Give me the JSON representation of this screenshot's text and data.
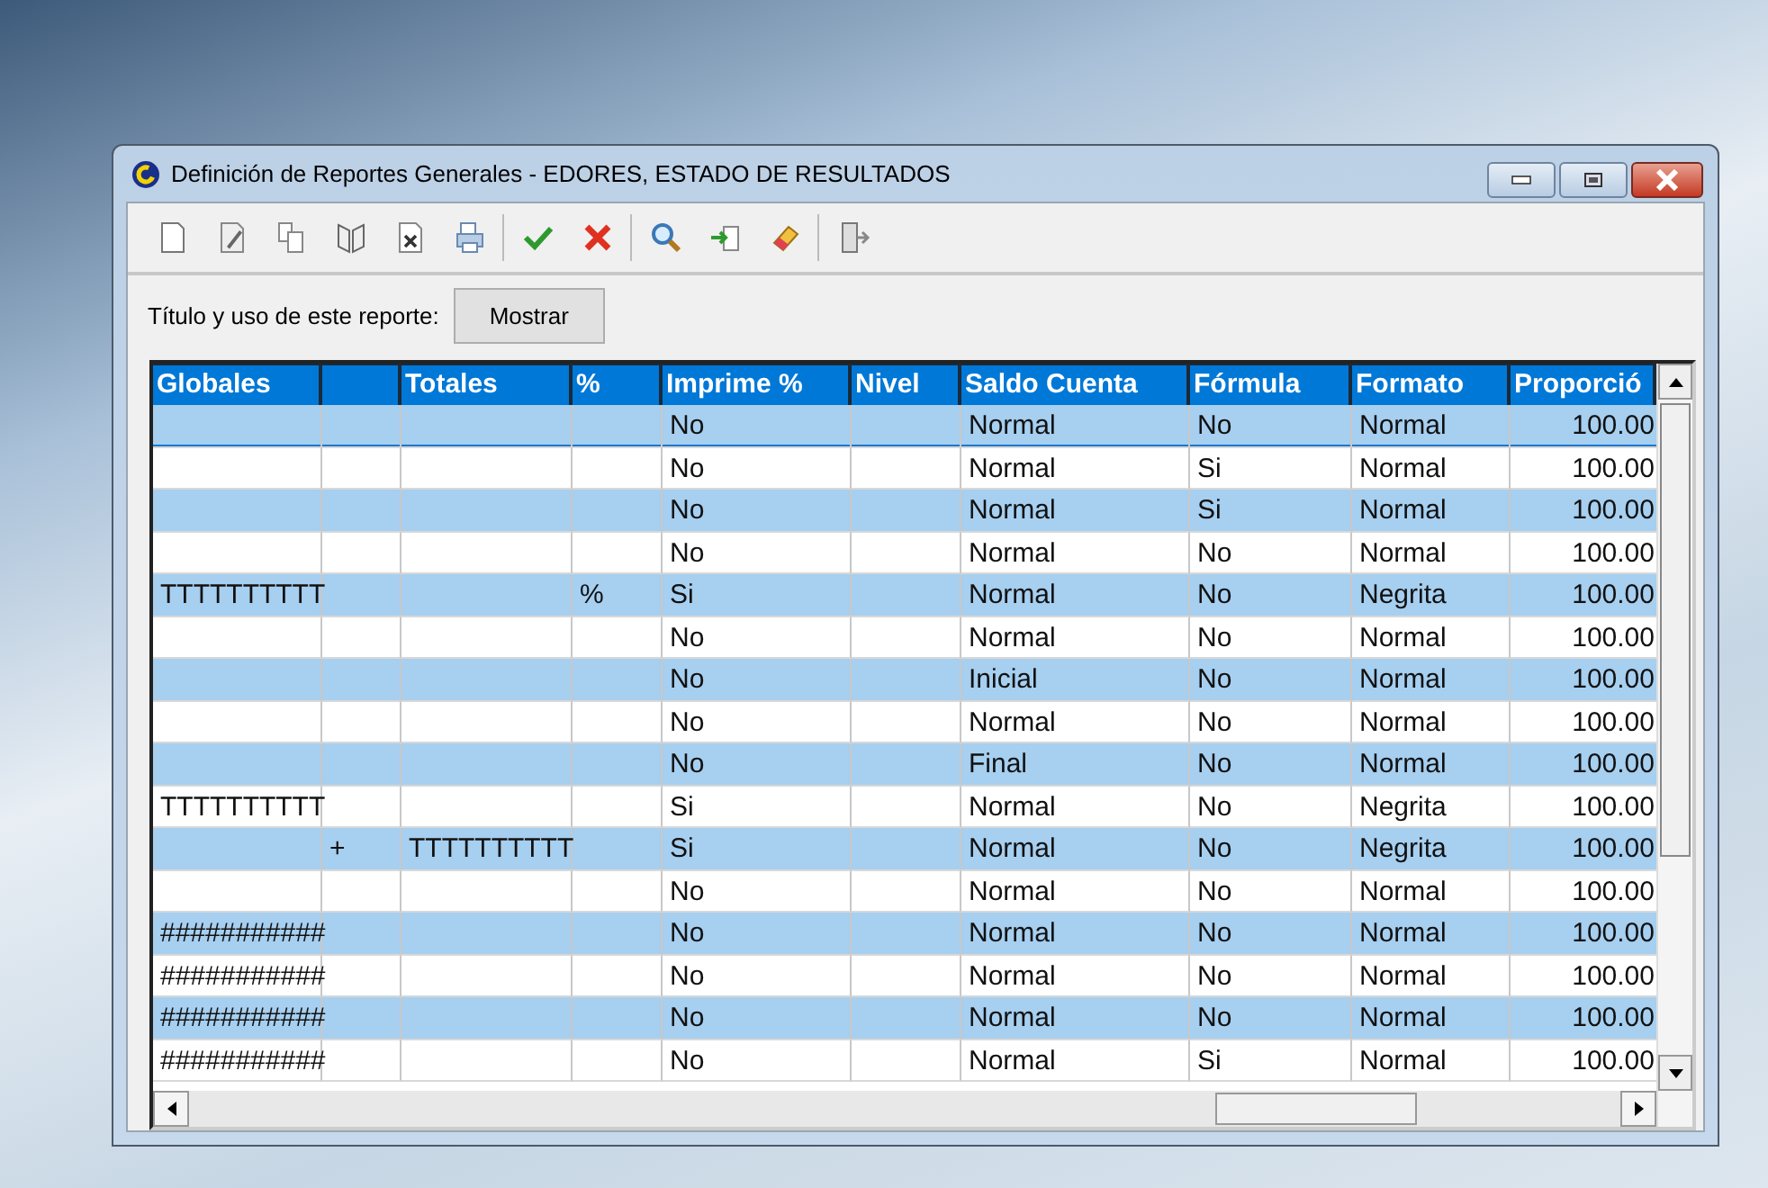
{
  "window": {
    "title": "Definición de Reportes Generales - EDORES, ESTADO DE RESULTADOS"
  },
  "toolbar": [
    {
      "kind": "new"
    },
    {
      "kind": "edit"
    },
    {
      "kind": "copy"
    },
    {
      "kind": "book"
    },
    {
      "kind": "delete"
    },
    {
      "kind": "print"
    },
    {
      "kind": "sep"
    },
    {
      "kind": "accept"
    },
    {
      "kind": "cancel"
    },
    {
      "kind": "sep"
    },
    {
      "kind": "search"
    },
    {
      "kind": "import"
    },
    {
      "kind": "eraser"
    },
    {
      "kind": "sep"
    },
    {
      "kind": "exit"
    }
  ],
  "report_usage": {
    "label": "Título y uso de este reporte:",
    "button": "Mostrar"
  },
  "table": {
    "columns": [
      "Globales",
      "",
      "Totales",
      "%",
      "Imprime %",
      "Nivel",
      "Saldo Cuenta",
      "Fórmula",
      "Formato",
      "Proporció"
    ],
    "rows": [
      {
        "selected": true,
        "cells": [
          "",
          "",
          "",
          "",
          "No",
          "",
          "Normal",
          "No",
          "Normal",
          "100.00"
        ]
      },
      {
        "selected": false,
        "cells": [
          "",
          "",
          "",
          "",
          "No",
          "",
          "Normal",
          "Si",
          "Normal",
          "100.00"
        ]
      },
      {
        "selected": false,
        "cells": [
          "",
          "",
          "",
          "",
          "No",
          "",
          "Normal",
          "Si",
          "Normal",
          "100.00"
        ]
      },
      {
        "selected": false,
        "cells": [
          "",
          "",
          "",
          "",
          "No",
          "",
          "Normal",
          "No",
          "Normal",
          "100.00"
        ]
      },
      {
        "selected": false,
        "cells": [
          "TTTTTTTTTT",
          "",
          "",
          "%",
          "Si",
          "",
          "Normal",
          "No",
          "Negrita",
          "100.00"
        ]
      },
      {
        "selected": false,
        "cells": [
          "",
          "",
          "",
          "",
          "No",
          "",
          "Normal",
          "No",
          "Normal",
          "100.00"
        ]
      },
      {
        "selected": false,
        "cells": [
          "",
          "",
          "",
          "",
          "No",
          "",
          "Inicial",
          "No",
          "Normal",
          "100.00"
        ]
      },
      {
        "selected": false,
        "cells": [
          "",
          "",
          "",
          "",
          "No",
          "",
          "Normal",
          "No",
          "Normal",
          "100.00"
        ]
      },
      {
        "selected": false,
        "cells": [
          "",
          "",
          "",
          "",
          "No",
          "",
          "Final",
          "No",
          "Normal",
          "100.00"
        ]
      },
      {
        "selected": false,
        "cells": [
          "TTTTTTTTTT",
          "",
          "",
          "",
          "Si",
          "",
          "Normal",
          "No",
          "Negrita",
          "100.00"
        ]
      },
      {
        "selected": false,
        "cells": [
          "",
          "+",
          "TTTTTTTTTT",
          "",
          "Si",
          "",
          "Normal",
          "No",
          "Negrita",
          "100.00"
        ]
      },
      {
        "selected": false,
        "cells": [
          "",
          "",
          "",
          "",
          "No",
          "",
          "Normal",
          "No",
          "Normal",
          "100.00"
        ]
      },
      {
        "selected": false,
        "cells": [
          "###########",
          "",
          "",
          "",
          "No",
          "",
          "Normal",
          "No",
          "Normal",
          "100.00"
        ]
      },
      {
        "selected": false,
        "cells": [
          "###########",
          "",
          "",
          "",
          "No",
          "",
          "Normal",
          "No",
          "Normal",
          "100.00"
        ]
      },
      {
        "selected": false,
        "cells": [
          "###########",
          "",
          "",
          "",
          "No",
          "",
          "Normal",
          "No",
          "Normal",
          "100.00"
        ]
      },
      {
        "selected": false,
        "cells": [
          "###########",
          "",
          "",
          "",
          "No",
          "",
          "Normal",
          "Si",
          "Normal",
          "100.00"
        ]
      }
    ]
  }
}
